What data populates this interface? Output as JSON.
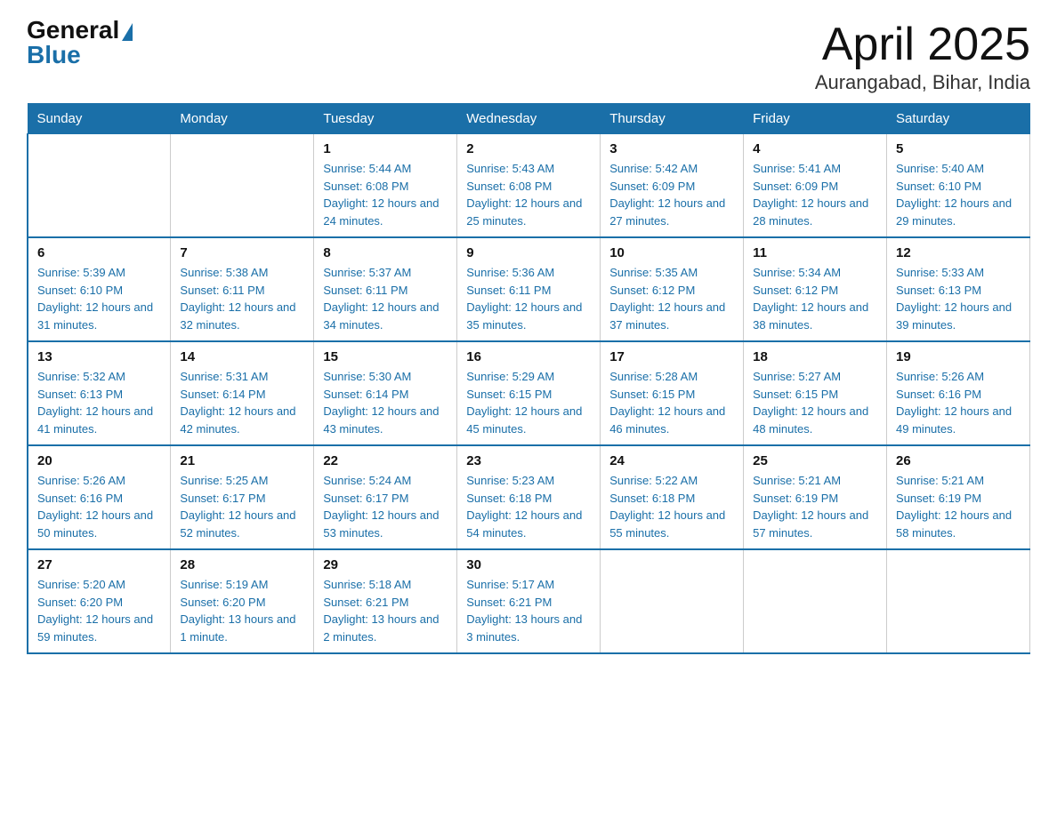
{
  "logo": {
    "general": "General",
    "blue": "Blue"
  },
  "title": "April 2025",
  "subtitle": "Aurangabad, Bihar, India",
  "days": [
    "Sunday",
    "Monday",
    "Tuesday",
    "Wednesday",
    "Thursday",
    "Friday",
    "Saturday"
  ],
  "weeks": [
    [
      {
        "num": "",
        "sunrise": "",
        "sunset": "",
        "daylight": ""
      },
      {
        "num": "",
        "sunrise": "",
        "sunset": "",
        "daylight": ""
      },
      {
        "num": "1",
        "sunrise": "Sunrise: 5:44 AM",
        "sunset": "Sunset: 6:08 PM",
        "daylight": "Daylight: 12 hours and 24 minutes."
      },
      {
        "num": "2",
        "sunrise": "Sunrise: 5:43 AM",
        "sunset": "Sunset: 6:08 PM",
        "daylight": "Daylight: 12 hours and 25 minutes."
      },
      {
        "num": "3",
        "sunrise": "Sunrise: 5:42 AM",
        "sunset": "Sunset: 6:09 PM",
        "daylight": "Daylight: 12 hours and 27 minutes."
      },
      {
        "num": "4",
        "sunrise": "Sunrise: 5:41 AM",
        "sunset": "Sunset: 6:09 PM",
        "daylight": "Daylight: 12 hours and 28 minutes."
      },
      {
        "num": "5",
        "sunrise": "Sunrise: 5:40 AM",
        "sunset": "Sunset: 6:10 PM",
        "daylight": "Daylight: 12 hours and 29 minutes."
      }
    ],
    [
      {
        "num": "6",
        "sunrise": "Sunrise: 5:39 AM",
        "sunset": "Sunset: 6:10 PM",
        "daylight": "Daylight: 12 hours and 31 minutes."
      },
      {
        "num": "7",
        "sunrise": "Sunrise: 5:38 AM",
        "sunset": "Sunset: 6:11 PM",
        "daylight": "Daylight: 12 hours and 32 minutes."
      },
      {
        "num": "8",
        "sunrise": "Sunrise: 5:37 AM",
        "sunset": "Sunset: 6:11 PM",
        "daylight": "Daylight: 12 hours and 34 minutes."
      },
      {
        "num": "9",
        "sunrise": "Sunrise: 5:36 AM",
        "sunset": "Sunset: 6:11 PM",
        "daylight": "Daylight: 12 hours and 35 minutes."
      },
      {
        "num": "10",
        "sunrise": "Sunrise: 5:35 AM",
        "sunset": "Sunset: 6:12 PM",
        "daylight": "Daylight: 12 hours and 37 minutes."
      },
      {
        "num": "11",
        "sunrise": "Sunrise: 5:34 AM",
        "sunset": "Sunset: 6:12 PM",
        "daylight": "Daylight: 12 hours and 38 minutes."
      },
      {
        "num": "12",
        "sunrise": "Sunrise: 5:33 AM",
        "sunset": "Sunset: 6:13 PM",
        "daylight": "Daylight: 12 hours and 39 minutes."
      }
    ],
    [
      {
        "num": "13",
        "sunrise": "Sunrise: 5:32 AM",
        "sunset": "Sunset: 6:13 PM",
        "daylight": "Daylight: 12 hours and 41 minutes."
      },
      {
        "num": "14",
        "sunrise": "Sunrise: 5:31 AM",
        "sunset": "Sunset: 6:14 PM",
        "daylight": "Daylight: 12 hours and 42 minutes."
      },
      {
        "num": "15",
        "sunrise": "Sunrise: 5:30 AM",
        "sunset": "Sunset: 6:14 PM",
        "daylight": "Daylight: 12 hours and 43 minutes."
      },
      {
        "num": "16",
        "sunrise": "Sunrise: 5:29 AM",
        "sunset": "Sunset: 6:15 PM",
        "daylight": "Daylight: 12 hours and 45 minutes."
      },
      {
        "num": "17",
        "sunrise": "Sunrise: 5:28 AM",
        "sunset": "Sunset: 6:15 PM",
        "daylight": "Daylight: 12 hours and 46 minutes."
      },
      {
        "num": "18",
        "sunrise": "Sunrise: 5:27 AM",
        "sunset": "Sunset: 6:15 PM",
        "daylight": "Daylight: 12 hours and 48 minutes."
      },
      {
        "num": "19",
        "sunrise": "Sunrise: 5:26 AM",
        "sunset": "Sunset: 6:16 PM",
        "daylight": "Daylight: 12 hours and 49 minutes."
      }
    ],
    [
      {
        "num": "20",
        "sunrise": "Sunrise: 5:26 AM",
        "sunset": "Sunset: 6:16 PM",
        "daylight": "Daylight: 12 hours and 50 minutes."
      },
      {
        "num": "21",
        "sunrise": "Sunrise: 5:25 AM",
        "sunset": "Sunset: 6:17 PM",
        "daylight": "Daylight: 12 hours and 52 minutes."
      },
      {
        "num": "22",
        "sunrise": "Sunrise: 5:24 AM",
        "sunset": "Sunset: 6:17 PM",
        "daylight": "Daylight: 12 hours and 53 minutes."
      },
      {
        "num": "23",
        "sunrise": "Sunrise: 5:23 AM",
        "sunset": "Sunset: 6:18 PM",
        "daylight": "Daylight: 12 hours and 54 minutes."
      },
      {
        "num": "24",
        "sunrise": "Sunrise: 5:22 AM",
        "sunset": "Sunset: 6:18 PM",
        "daylight": "Daylight: 12 hours and 55 minutes."
      },
      {
        "num": "25",
        "sunrise": "Sunrise: 5:21 AM",
        "sunset": "Sunset: 6:19 PM",
        "daylight": "Daylight: 12 hours and 57 minutes."
      },
      {
        "num": "26",
        "sunrise": "Sunrise: 5:21 AM",
        "sunset": "Sunset: 6:19 PM",
        "daylight": "Daylight: 12 hours and 58 minutes."
      }
    ],
    [
      {
        "num": "27",
        "sunrise": "Sunrise: 5:20 AM",
        "sunset": "Sunset: 6:20 PM",
        "daylight": "Daylight: 12 hours and 59 minutes."
      },
      {
        "num": "28",
        "sunrise": "Sunrise: 5:19 AM",
        "sunset": "Sunset: 6:20 PM",
        "daylight": "Daylight: 13 hours and 1 minute."
      },
      {
        "num": "29",
        "sunrise": "Sunrise: 5:18 AM",
        "sunset": "Sunset: 6:21 PM",
        "daylight": "Daylight: 13 hours and 2 minutes."
      },
      {
        "num": "30",
        "sunrise": "Sunrise: 5:17 AM",
        "sunset": "Sunset: 6:21 PM",
        "daylight": "Daylight: 13 hours and 3 minutes."
      },
      {
        "num": "",
        "sunrise": "",
        "sunset": "",
        "daylight": ""
      },
      {
        "num": "",
        "sunrise": "",
        "sunset": "",
        "daylight": ""
      },
      {
        "num": "",
        "sunrise": "",
        "sunset": "",
        "daylight": ""
      }
    ]
  ]
}
